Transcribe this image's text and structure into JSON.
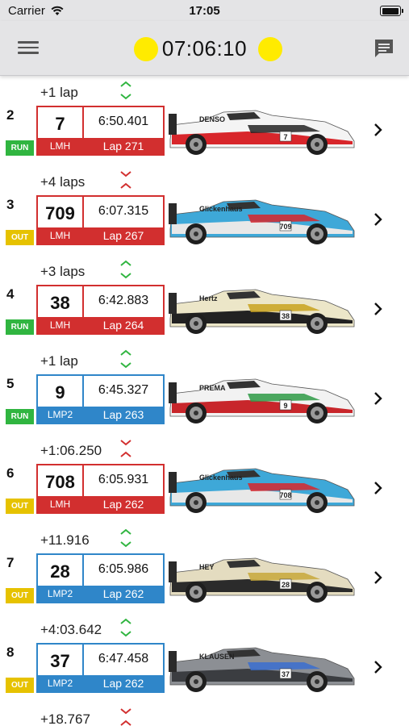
{
  "status_bar": {
    "carrier": "Carrier",
    "time": "17:05",
    "battery_level": 1.0
  },
  "nav": {
    "race_clock": "07:06:10",
    "flag_color": "#ffeb00",
    "menu_icon": "hamburger-menu-icon",
    "chat_icon": "chat-icon"
  },
  "colors": {
    "lmh": "#d22f2f",
    "lmp2": "#2f86c9",
    "run": "#30b540",
    "out": "#e6c200",
    "trend_up": "#30b540",
    "trend_down": "#d22f2f"
  },
  "leading_gap": {
    "text": "+1 lap",
    "trend": "up"
  },
  "entries": [
    {
      "position": "2",
      "status": "RUN",
      "number": "7",
      "class": "LMH",
      "last_lap": "6:50.401",
      "lap": "Lap 271",
      "gap_text": "+4 laps",
      "trend": "down",
      "livery": {
        "body": "#f4f4f4",
        "stripe": "#d8262b",
        "accent": "#222222",
        "text": "DENSO"
      }
    },
    {
      "position": "3",
      "status": "OUT",
      "number": "709",
      "class": "LMH",
      "last_lap": "6:07.315",
      "lap": "Lap 267",
      "gap_text": "+3 laps",
      "trend": "up",
      "livery": {
        "body": "#3ea8d8",
        "stripe": "#e8e8e8",
        "accent": "#d8262b",
        "text": "Glickenhaus"
      }
    },
    {
      "position": "4",
      "status": "RUN",
      "number": "38",
      "class": "LMH",
      "last_lap": "6:42.883",
      "lap": "Lap 264",
      "gap_text": "+1 lap",
      "trend": "up",
      "livery": {
        "body": "#ece6c8",
        "stripe": "#222222",
        "accent": "#c9a21e",
        "text": "Hertz"
      }
    },
    {
      "position": "5",
      "status": "RUN",
      "number": "9",
      "class": "LMP2",
      "last_lap": "6:45.327",
      "lap": "Lap 263",
      "gap_text": "+1:06.250",
      "trend": "down",
      "livery": {
        "body": "#f2f2f2",
        "stripe": "#c8262b",
        "accent": "#2e9a45",
        "text": "PREMA"
      }
    },
    {
      "position": "6",
      "status": "OUT",
      "number": "708",
      "class": "LMH",
      "last_lap": "6:05.931",
      "lap": "Lap 262",
      "gap_text": "+11.916",
      "trend": "up",
      "livery": {
        "body": "#3ea8d8",
        "stripe": "#e8e8e8",
        "accent": "#d8262b",
        "text": "Glickenhaus"
      }
    },
    {
      "position": "7",
      "status": "OUT",
      "number": "28",
      "class": "LMP2",
      "last_lap": "6:05.986",
      "lap": "Lap 262",
      "gap_text": "+4:03.642",
      "trend": "up",
      "livery": {
        "body": "#e4dcc0",
        "stripe": "#2b2b2b",
        "accent": "#c8a83a",
        "text": "HEY"
      }
    },
    {
      "position": "8",
      "status": "OUT",
      "number": "37",
      "class": "LMP2",
      "last_lap": "6:47.458",
      "lap": "Lap 262",
      "gap_text": "+18.767",
      "trend": "down",
      "livery": {
        "body": "#8c8f94",
        "stripe": "#3b3d41",
        "accent": "#3a6fd0",
        "text": "KLAUSEN"
      }
    }
  ]
}
